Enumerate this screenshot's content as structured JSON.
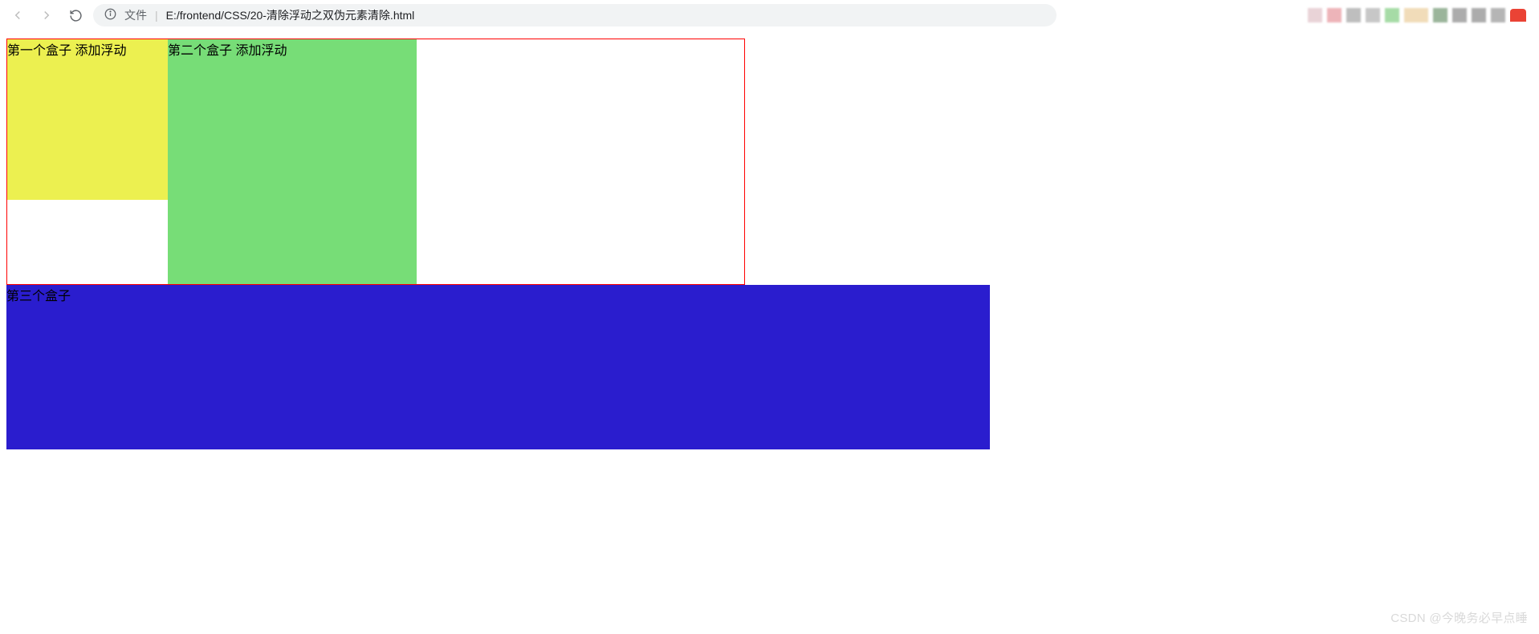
{
  "browser": {
    "file_label": "文件",
    "url": "E:/frontend/CSS/20-清除浮动之双伪元素清除.html"
  },
  "boxes": {
    "box1_text": "第一个盒子 添加浮动",
    "box2_text": "第二个盒子 添加浮动",
    "box3_text": "第三个盒子"
  },
  "watermark": "CSDN @今晚务必早点睡",
  "colors": {
    "container_border": "#ff0000",
    "box1_bg": "#ecf050",
    "box2_bg": "#77dd77",
    "box3_bg": "#2a1dce"
  }
}
